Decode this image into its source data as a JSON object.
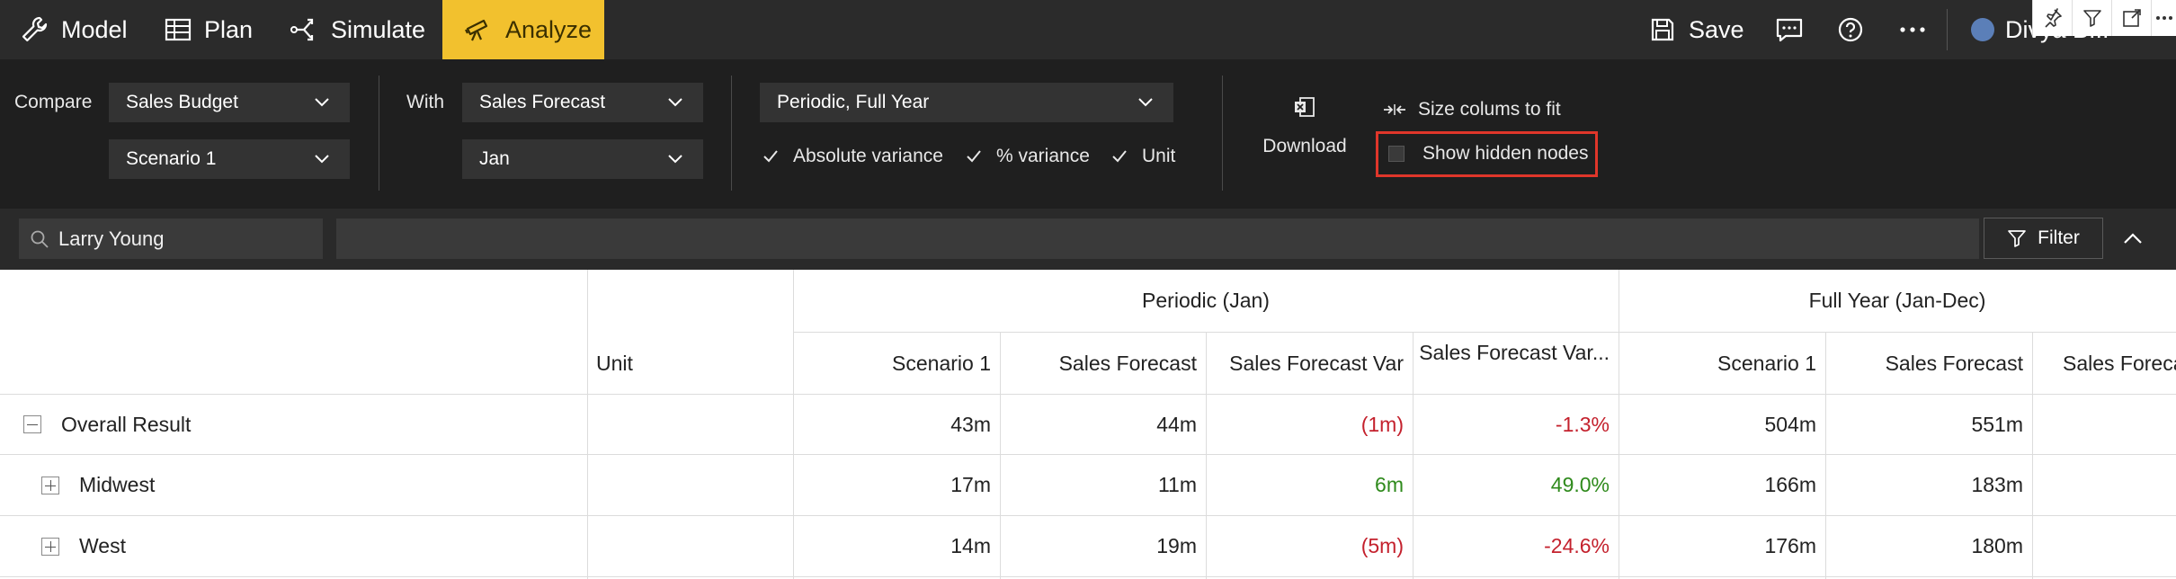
{
  "nav": {
    "items": [
      {
        "label": "Model",
        "icon": "wrench-icon"
      },
      {
        "label": "Plan",
        "icon": "table-icon"
      },
      {
        "label": "Simulate",
        "icon": "branch-icon"
      },
      {
        "label": "Analyze",
        "icon": "telescope-icon",
        "active": true
      }
    ],
    "save_label": "Save",
    "user_label": "Divya B..."
  },
  "toolbar": {
    "compare_label": "Compare",
    "compare_select": "Sales Budget",
    "compare_scenario": "Scenario 1",
    "with_label": "With",
    "with_select": "Sales Forecast",
    "with_period": "Jan",
    "period_select": "Periodic, Full Year",
    "checks": [
      {
        "label": "Absolute variance",
        "checked": true
      },
      {
        "label": "% variance",
        "checked": true
      },
      {
        "label": "Unit",
        "checked": true
      }
    ],
    "download_label": "Download",
    "size_columns_label": "Size colums to fit",
    "show_hidden_label": "Show hidden nodes"
  },
  "search": {
    "value": "Larry Young",
    "filter_label": "Filter"
  },
  "table": {
    "unit_header": "Unit",
    "group_periodic": "Periodic (Jan)",
    "group_fullyear": "Full Year (Jan-Dec)",
    "columns": [
      "Scenario 1",
      "Sales Forecast",
      "Sales Forecast Var",
      "Sales Forecast Var...",
      "Scenario 1",
      "Sales Forecast",
      "Sales Foreca"
    ],
    "rows": [
      {
        "name": "Overall Result",
        "expanded": true,
        "values": [
          "43m",
          "44m",
          "(1m)",
          "-1.3%",
          "504m",
          "551m"
        ],
        "tone": "neg"
      },
      {
        "name": "Midwest",
        "expanded": false,
        "values": [
          "17m",
          "11m",
          "6m",
          "49.0%",
          "166m",
          "183m"
        ],
        "tone": "pos"
      },
      {
        "name": "West",
        "expanded": false,
        "values": [
          "14m",
          "19m",
          "(5m)",
          "-24.6%",
          "176m",
          "180m"
        ],
        "tone": "neg"
      }
    ]
  },
  "colors": {
    "nav_bg": "#2b2b2b",
    "accent": "#f2c12e",
    "negative": "#c4212d",
    "positive": "#2f8a1c",
    "highlight": "#e0362a"
  }
}
